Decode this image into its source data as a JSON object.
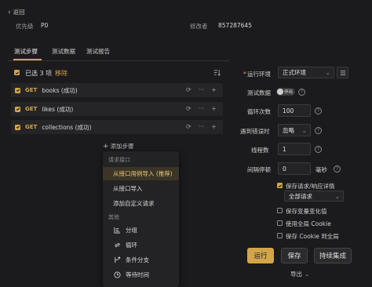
{
  "nav": {
    "back_label": "返回"
  },
  "meta": {
    "priority_label": "优先级",
    "priority_value": "P0",
    "modifier_label": "修改者",
    "modifier_value": "857287645"
  },
  "tabs": [
    {
      "label": "测试步骤",
      "active": true
    },
    {
      "label": "测试数据",
      "active": false
    },
    {
      "label": "测试报告",
      "active": false
    }
  ],
  "selection": {
    "text": "已选 3 项",
    "remove_label": "移除"
  },
  "steps": [
    {
      "method": "GET",
      "name": "books (成功)"
    },
    {
      "method": "GET",
      "name": "likes (成功)"
    },
    {
      "method": "GET",
      "name": "collections (成功)"
    }
  ],
  "add_step": {
    "label": "添加步骤"
  },
  "dropdown": {
    "section1": "请求接口",
    "items1": [
      "从接口用例导入 (推荐)",
      "从接口导入",
      "添加自定义请求"
    ],
    "section2": "其他",
    "items2": [
      {
        "label": "分组",
        "icon": "group-icon"
      },
      {
        "label": "循环",
        "icon": "loop-icon"
      },
      {
        "label": "条件分支",
        "icon": "branch-icon"
      },
      {
        "label": "等待时间",
        "icon": "clock-icon"
      }
    ]
  },
  "settings": {
    "env_label": "运行环境",
    "env_value": "正式环境",
    "data_label": "测试数据",
    "data_toggle": "停用",
    "loop_label": "循环次数",
    "loop_value": "100",
    "error_label": "遇到错误时",
    "error_value": "忽略",
    "thread_label": "线程数",
    "thread_value": "1",
    "interval_label": "间隔停顿",
    "interval_value": "0",
    "interval_unit": "毫秒",
    "save_req_label": "保存请求/响应详情",
    "all_req_value": "全部请求",
    "save_var_label": "保存变量变化值",
    "global_cookie_label": "使用全局 Cookie",
    "save_cookie_label": "保存 Cookie 到全局"
  },
  "actions": {
    "run": "运行",
    "save": "保存",
    "ci": "持续集成",
    "export": "导出"
  },
  "colors": {
    "accent": "#d2a54a",
    "bg": "#1b1b1d",
    "row_bg": "#252527"
  }
}
